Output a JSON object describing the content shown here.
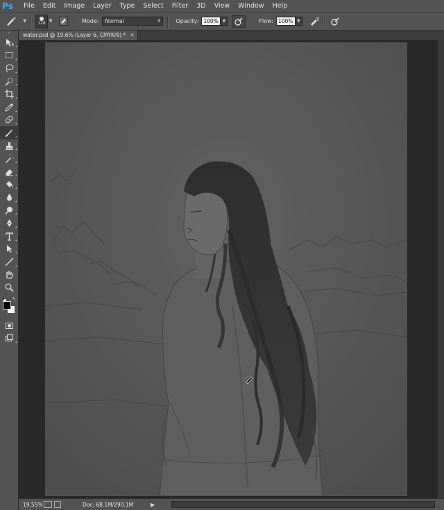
{
  "app": {
    "logo": "Ps"
  },
  "menu": [
    "File",
    "Edit",
    "Image",
    "Layer",
    "Type",
    "Select",
    "Filter",
    "3D",
    "View",
    "Window",
    "Help"
  ],
  "options": {
    "brush_size": "128",
    "mode_label": "Mode:",
    "mode_value": "Normal",
    "opacity_label": "Opacity:",
    "opacity_value": "100%",
    "flow_label": "Flow:",
    "flow_value": "100%"
  },
  "document": {
    "tab_title": "water.psd @ 19.6% (Layer 6, CMYK/8) *",
    "close": "×"
  },
  "status": {
    "zoom": "19.55%",
    "doc_info": "Doc: 68.1M/290.1M",
    "arrow": "▶"
  },
  "tools": [
    "move-icon",
    "marquee-icon",
    "lasso-icon",
    "quick-select-icon",
    "crop-icon",
    "eyedropper-icon",
    "healing-brush-icon",
    "brush-icon",
    "clone-stamp-icon",
    "history-brush-icon",
    "eraser-icon",
    "paint-bucket-icon",
    "blur-icon",
    "dodge-icon",
    "pen-icon",
    "type-icon",
    "path-select-icon",
    "line-icon",
    "hand-icon",
    "zoom-icon"
  ],
  "colors": {
    "foreground": "#000000",
    "background": "#ffffff",
    "ui_panel": "#535353",
    "canvas": "#555555",
    "accent": "#31a8ff"
  }
}
